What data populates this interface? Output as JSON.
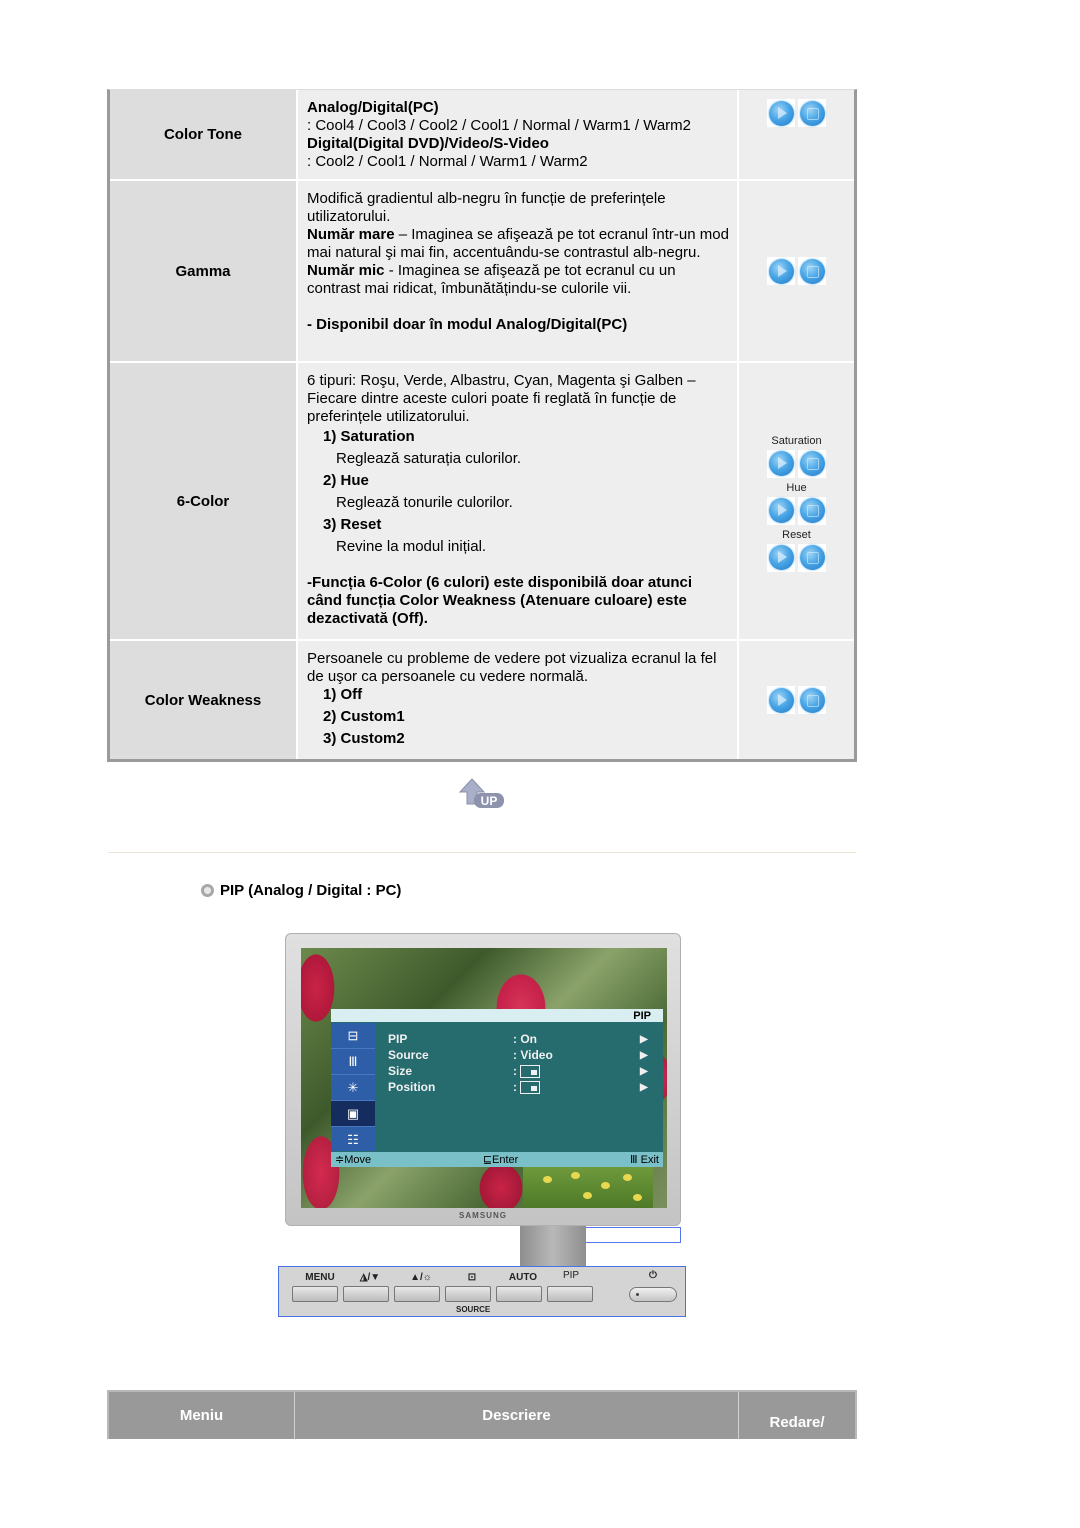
{
  "table": {
    "rows": [
      {
        "menu": "Color Tone",
        "desc": {
          "h1": "Analog/Digital(PC)",
          "l1": ": Cool4 / Cool3 / Cool2 / Cool1 / Normal / Warm1 / Warm2",
          "h2": "Digital(Digital DVD)/Video/S-Video",
          "l2": ": Cool2 / Cool1 / Normal / Warm1 / Warm2"
        }
      },
      {
        "menu": "Gamma",
        "desc": {
          "intro": "Modifică gradientul alb-negru în funcție de preferințele utilizatorului.",
          "big_label": "Număr mare",
          "big_text": " – Imaginea se afişează pe tot ecranul într-un mod mai natural şi mai fin, accentuându-se contrastul alb-negru.",
          "small_label": "Număr mic",
          "small_text": " - Imaginea se afişează pe tot ecranul cu un contrast mai ridicat, îmbunătățindu-se culorile vii.",
          "note": "- Disponibil doar în modul Analog/Digital(PC)"
        }
      },
      {
        "menu": "6-Color",
        "desc": {
          "intro": "6 tipuri: Roşu, Verde, Albastru, Cyan, Magenta şi Galben – Fiecare dintre aceste culori poate fi reglată în funcție de preferințele utilizatorului.",
          "items": [
            {
              "title": "1) Saturation",
              "text": "Reglează saturația culorilor."
            },
            {
              "title": "2) Hue",
              "text": "Reglează tonurile culorilor."
            },
            {
              "title": "3) Reset",
              "text": "Revine la modul inițial."
            }
          ],
          "note": "-Funcția 6-Color (6 culori) este disponibilă doar atunci când funcția Color Weakness (Atenuare culoare) este dezactivată (Off)."
        },
        "play_labels": [
          "Saturation",
          "Hue",
          "Reset"
        ]
      },
      {
        "menu": "Color Weakness",
        "desc": {
          "intro": "Persoanele cu probleme de vedere pot vizualiza ecranul la fel de uşor ca persoanele cu vedere normală.",
          "items": [
            "1) Off",
            "2) Custom1",
            "3) Custom2"
          ]
        }
      }
    ]
  },
  "section": {
    "title": "PIP (Analog / Digital : PC)"
  },
  "osd": {
    "header": "PIP",
    "rows": [
      {
        "name": "PIP",
        "value": ": On"
      },
      {
        "name": "Source",
        "value": ": Video"
      },
      {
        "name": "Size",
        "value": ":"
      },
      {
        "name": "Position",
        "value": ":"
      }
    ],
    "footer": {
      "move": "≑Move",
      "enter": "⊑Enter",
      "exit": "Ⅲ Exit"
    },
    "brand": "SAMSUNG"
  },
  "panel": {
    "buttons": [
      "MENU",
      "◮/▼",
      "▲/☼",
      "⊡",
      "AUTO",
      "PIP"
    ],
    "source_label": "SOURCE",
    "power_icon": "⏻"
  },
  "footer_table": {
    "col1": "Meniu",
    "col2": "Descriere",
    "col3": "Redare/"
  }
}
